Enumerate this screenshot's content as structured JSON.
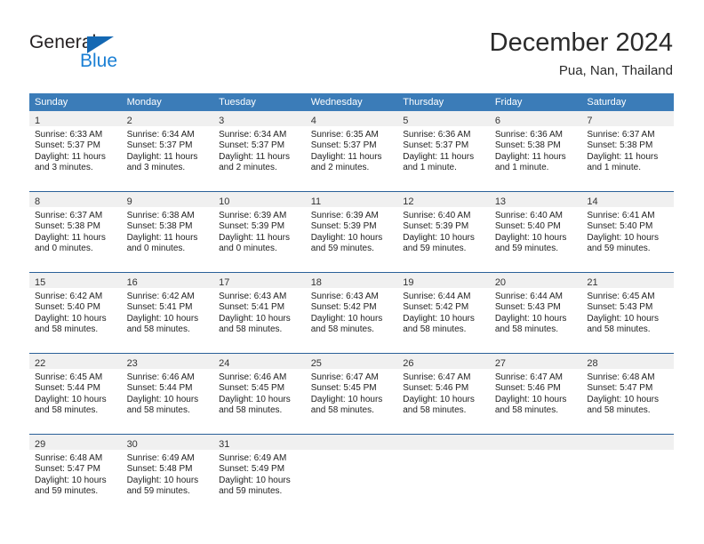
{
  "brand": {
    "name_part1": "General",
    "name_part2": "Blue",
    "triangle_icon": "triangle-icon",
    "color_dark": "#231f20",
    "color_blue": "#1a7fd4"
  },
  "header": {
    "title": "December 2024",
    "subtitle": "Pua, Nan, Thailand"
  },
  "theme": {
    "header_row_bg": "#3b7cb8",
    "row_divider": "#2a6099",
    "daynum_band_bg": "#f0f0f0",
    "text": "#222222"
  },
  "weekdays": [
    "Sunday",
    "Monday",
    "Tuesday",
    "Wednesday",
    "Thursday",
    "Friday",
    "Saturday"
  ],
  "weeks": [
    [
      {
        "day": "1",
        "sunrise": "Sunrise: 6:33 AM",
        "sunset": "Sunset: 5:37 PM",
        "daylight1": "Daylight: 11 hours",
        "daylight2": "and 3 minutes."
      },
      {
        "day": "2",
        "sunrise": "Sunrise: 6:34 AM",
        "sunset": "Sunset: 5:37 PM",
        "daylight1": "Daylight: 11 hours",
        "daylight2": "and 3 minutes."
      },
      {
        "day": "3",
        "sunrise": "Sunrise: 6:34 AM",
        "sunset": "Sunset: 5:37 PM",
        "daylight1": "Daylight: 11 hours",
        "daylight2": "and 2 minutes."
      },
      {
        "day": "4",
        "sunrise": "Sunrise: 6:35 AM",
        "sunset": "Sunset: 5:37 PM",
        "daylight1": "Daylight: 11 hours",
        "daylight2": "and 2 minutes."
      },
      {
        "day": "5",
        "sunrise": "Sunrise: 6:36 AM",
        "sunset": "Sunset: 5:37 PM",
        "daylight1": "Daylight: 11 hours",
        "daylight2": "and 1 minute."
      },
      {
        "day": "6",
        "sunrise": "Sunrise: 6:36 AM",
        "sunset": "Sunset: 5:38 PM",
        "daylight1": "Daylight: 11 hours",
        "daylight2": "and 1 minute."
      },
      {
        "day": "7",
        "sunrise": "Sunrise: 6:37 AM",
        "sunset": "Sunset: 5:38 PM",
        "daylight1": "Daylight: 11 hours",
        "daylight2": "and 1 minute."
      }
    ],
    [
      {
        "day": "8",
        "sunrise": "Sunrise: 6:37 AM",
        "sunset": "Sunset: 5:38 PM",
        "daylight1": "Daylight: 11 hours",
        "daylight2": "and 0 minutes."
      },
      {
        "day": "9",
        "sunrise": "Sunrise: 6:38 AM",
        "sunset": "Sunset: 5:38 PM",
        "daylight1": "Daylight: 11 hours",
        "daylight2": "and 0 minutes."
      },
      {
        "day": "10",
        "sunrise": "Sunrise: 6:39 AM",
        "sunset": "Sunset: 5:39 PM",
        "daylight1": "Daylight: 11 hours",
        "daylight2": "and 0 minutes."
      },
      {
        "day": "11",
        "sunrise": "Sunrise: 6:39 AM",
        "sunset": "Sunset: 5:39 PM",
        "daylight1": "Daylight: 10 hours",
        "daylight2": "and 59 minutes."
      },
      {
        "day": "12",
        "sunrise": "Sunrise: 6:40 AM",
        "sunset": "Sunset: 5:39 PM",
        "daylight1": "Daylight: 10 hours",
        "daylight2": "and 59 minutes."
      },
      {
        "day": "13",
        "sunrise": "Sunrise: 6:40 AM",
        "sunset": "Sunset: 5:40 PM",
        "daylight1": "Daylight: 10 hours",
        "daylight2": "and 59 minutes."
      },
      {
        "day": "14",
        "sunrise": "Sunrise: 6:41 AM",
        "sunset": "Sunset: 5:40 PM",
        "daylight1": "Daylight: 10 hours",
        "daylight2": "and 59 minutes."
      }
    ],
    [
      {
        "day": "15",
        "sunrise": "Sunrise: 6:42 AM",
        "sunset": "Sunset: 5:40 PM",
        "daylight1": "Daylight: 10 hours",
        "daylight2": "and 58 minutes."
      },
      {
        "day": "16",
        "sunrise": "Sunrise: 6:42 AM",
        "sunset": "Sunset: 5:41 PM",
        "daylight1": "Daylight: 10 hours",
        "daylight2": "and 58 minutes."
      },
      {
        "day": "17",
        "sunrise": "Sunrise: 6:43 AM",
        "sunset": "Sunset: 5:41 PM",
        "daylight1": "Daylight: 10 hours",
        "daylight2": "and 58 minutes."
      },
      {
        "day": "18",
        "sunrise": "Sunrise: 6:43 AM",
        "sunset": "Sunset: 5:42 PM",
        "daylight1": "Daylight: 10 hours",
        "daylight2": "and 58 minutes."
      },
      {
        "day": "19",
        "sunrise": "Sunrise: 6:44 AM",
        "sunset": "Sunset: 5:42 PM",
        "daylight1": "Daylight: 10 hours",
        "daylight2": "and 58 minutes."
      },
      {
        "day": "20",
        "sunrise": "Sunrise: 6:44 AM",
        "sunset": "Sunset: 5:43 PM",
        "daylight1": "Daylight: 10 hours",
        "daylight2": "and 58 minutes."
      },
      {
        "day": "21",
        "sunrise": "Sunrise: 6:45 AM",
        "sunset": "Sunset: 5:43 PM",
        "daylight1": "Daylight: 10 hours",
        "daylight2": "and 58 minutes."
      }
    ],
    [
      {
        "day": "22",
        "sunrise": "Sunrise: 6:45 AM",
        "sunset": "Sunset: 5:44 PM",
        "daylight1": "Daylight: 10 hours",
        "daylight2": "and 58 minutes."
      },
      {
        "day": "23",
        "sunrise": "Sunrise: 6:46 AM",
        "sunset": "Sunset: 5:44 PM",
        "daylight1": "Daylight: 10 hours",
        "daylight2": "and 58 minutes."
      },
      {
        "day": "24",
        "sunrise": "Sunrise: 6:46 AM",
        "sunset": "Sunset: 5:45 PM",
        "daylight1": "Daylight: 10 hours",
        "daylight2": "and 58 minutes."
      },
      {
        "day": "25",
        "sunrise": "Sunrise: 6:47 AM",
        "sunset": "Sunset: 5:45 PM",
        "daylight1": "Daylight: 10 hours",
        "daylight2": "and 58 minutes."
      },
      {
        "day": "26",
        "sunrise": "Sunrise: 6:47 AM",
        "sunset": "Sunset: 5:46 PM",
        "daylight1": "Daylight: 10 hours",
        "daylight2": "and 58 minutes."
      },
      {
        "day": "27",
        "sunrise": "Sunrise: 6:47 AM",
        "sunset": "Sunset: 5:46 PM",
        "daylight1": "Daylight: 10 hours",
        "daylight2": "and 58 minutes."
      },
      {
        "day": "28",
        "sunrise": "Sunrise: 6:48 AM",
        "sunset": "Sunset: 5:47 PM",
        "daylight1": "Daylight: 10 hours",
        "daylight2": "and 58 minutes."
      }
    ],
    [
      {
        "day": "29",
        "sunrise": "Sunrise: 6:48 AM",
        "sunset": "Sunset: 5:47 PM",
        "daylight1": "Daylight: 10 hours",
        "daylight2": "and 59 minutes."
      },
      {
        "day": "30",
        "sunrise": "Sunrise: 6:49 AM",
        "sunset": "Sunset: 5:48 PM",
        "daylight1": "Daylight: 10 hours",
        "daylight2": "and 59 minutes."
      },
      {
        "day": "31",
        "sunrise": "Sunrise: 6:49 AM",
        "sunset": "Sunset: 5:49 PM",
        "daylight1": "Daylight: 10 hours",
        "daylight2": "and 59 minutes."
      },
      {
        "day": "",
        "sunrise": "",
        "sunset": "",
        "daylight1": "",
        "daylight2": ""
      },
      {
        "day": "",
        "sunrise": "",
        "sunset": "",
        "daylight1": "",
        "daylight2": ""
      },
      {
        "day": "",
        "sunrise": "",
        "sunset": "",
        "daylight1": "",
        "daylight2": ""
      },
      {
        "day": "",
        "sunrise": "",
        "sunset": "",
        "daylight1": "",
        "daylight2": ""
      }
    ]
  ]
}
